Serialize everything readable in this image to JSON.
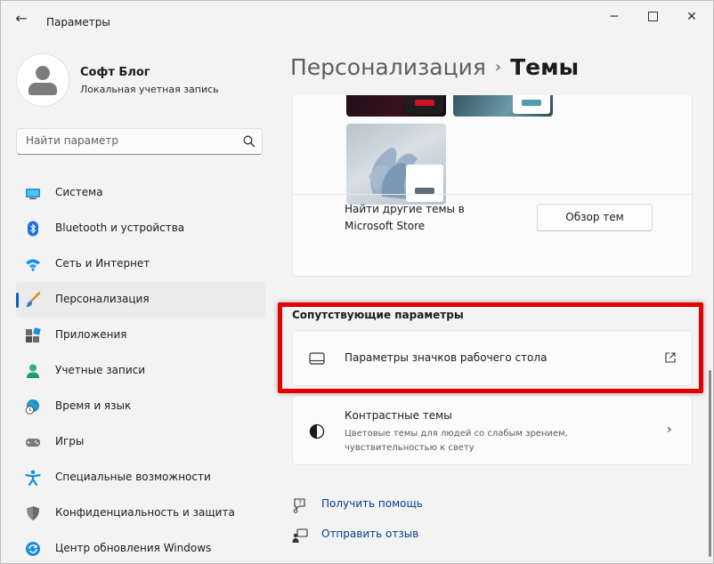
{
  "window": {
    "title": "Параметры"
  },
  "profile": {
    "name": "Софт Блог",
    "account_type": "Локальная учетная запись"
  },
  "search": {
    "placeholder": "Найти параметр"
  },
  "nav": {
    "items": [
      {
        "label": "Система",
        "icon": "monitor-icon"
      },
      {
        "label": "Bluetooth и устройства",
        "icon": "bluetooth-icon"
      },
      {
        "label": "Сеть и Интернет",
        "icon": "wifi-icon"
      },
      {
        "label": "Персонализация",
        "icon": "brush-icon",
        "active": true
      },
      {
        "label": "Приложения",
        "icon": "apps-icon"
      },
      {
        "label": "Учетные записи",
        "icon": "person-icon"
      },
      {
        "label": "Время и язык",
        "icon": "globe-clock-icon"
      },
      {
        "label": "Игры",
        "icon": "gamepad-icon"
      },
      {
        "label": "Специальные возможности",
        "icon": "accessibility-icon"
      },
      {
        "label": "Конфиденциальность и защита",
        "icon": "shield-icon"
      },
      {
        "label": "Центр обновления Windows",
        "icon": "update-icon"
      }
    ]
  },
  "breadcrumb": {
    "parent": "Персонализация",
    "separator": "›",
    "current": "Темы"
  },
  "themes": {
    "store_text": "Найти другие темы в Microsoft Store",
    "browse_button": "Обзор тем"
  },
  "related": {
    "section_title": "Сопутствующие параметры",
    "desktop_icons_label": "Параметры значков рабочего стола",
    "contrast_title": "Контрастные темы",
    "contrast_desc": "Цветовые темы для людей со слабым зрением, чувствительностью к свету"
  },
  "help": {
    "get_help": "Получить помощь",
    "feedback": "Отправить отзыв"
  },
  "colors": {
    "accent": "#0067c0",
    "highlight": "#e50000",
    "link": "#003e92"
  }
}
